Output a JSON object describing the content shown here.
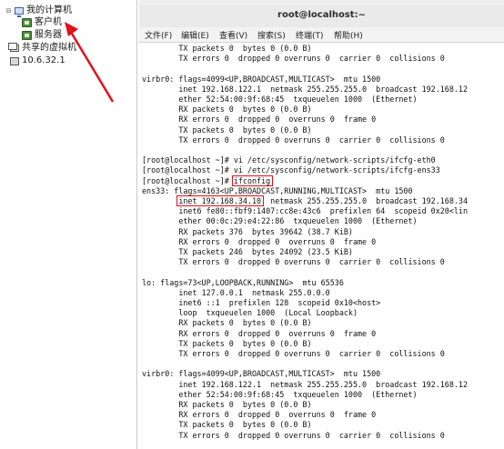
{
  "tree": {
    "items": [
      {
        "label": "我的计算机",
        "icon": "computer-icon",
        "twisty": "⊟"
      },
      {
        "label": "客户机",
        "icon": "vm-icon"
      },
      {
        "label": "服务器",
        "icon": "vm-icon"
      },
      {
        "label": "共享的虚拟机",
        "icon": "shared-vms-icon"
      },
      {
        "label": "10.6.32.1",
        "icon": "remote-host-icon"
      }
    ]
  },
  "window": {
    "title": "root@localhost:~",
    "menu": [
      "文件(F)",
      "编辑(E)",
      "查看(V)",
      "搜索(S)",
      "终端(T)",
      "帮助(H)"
    ]
  },
  "terminal": {
    "lines": [
      "        TX packets 0  bytes 0 (0.0 B)",
      "        TX errors 0  dropped 0 overruns 0  carrier 0  collisions 0",
      "",
      "virbr0: flags=4099<UP,BROADCAST,MULTICAST>  mtu 1500",
      "        inet 192.168.122.1  netmask 255.255.255.0  broadcast 192.168.12",
      "        ether 52:54:00:9f:68:45  txqueuelen 1000  (Ethernet)",
      "        RX packets 0  bytes 0 (0.0 B)",
      "        RX errors 0  dropped 0  overruns 0  frame 0",
      "        TX packets 0  bytes 0 (0.0 B)",
      "        TX errors 0  dropped 0 overruns 0  carrier 0  collisions 0",
      "",
      "[root@localhost ~]# vi /etc/sysconfig/network-scripts/ifcfg-eth0",
      "[root@localhost ~]# vi /etc/sysconfig/network-scripts/ifcfg-ens33",
      "[root@localhost ~]# ifconfig",
      "ens33: flags=4163<UP,BROADCAST,RUNNING,MULTICAST>  mtu 1500",
      "        inet 192.168.34.10  netmask 255.255.255.0  broadcast 192.168.34",
      "        inet6 fe80::fbf9:1407:cc8e:43c6  prefixlen 64  scopeid 0x20<lin",
      "        ether 00:0c:29:e4:22:86  txqueuelen 1000  (Ethernet)",
      "        RX packets 376  bytes 39642 (38.7 KiB)",
      "        RX errors 0  dropped 0  overruns 0  frame 0",
      "        TX packets 246  bytes 24092 (23.5 KiB)",
      "        TX errors 0  dropped 0 overruns 0  carrier 0  collisions 0",
      "",
      "lo: flags=73<UP,LOOPBACK,RUNNING>  mtu 65536",
      "        inet 127.0.0.1  netmask 255.0.0.0",
      "        inet6 ::1  prefixlen 128  scopeid 0x10<host>",
      "        loop  txqueuelen 1000  (Local Loopback)",
      "        RX packets 0  bytes 0 (0.0 B)",
      "        RX errors 0  dropped 0  overruns 0  frame 0",
      "        TX packets 0  bytes 0 (0.0 B)",
      "        TX errors 0  dropped 0 overruns 0  carrier 0  collisions 0",
      "",
      "virbr0: flags=4099<UP,BROADCAST,MULTICAST>  mtu 1500",
      "        inet 192.168.122.1  netmask 255.255.255.0  broadcast 192.168.12",
      "        ether 52:54:00:9f:68:45  txqueuelen 1000  (Ethernet)",
      "        RX packets 0  bytes 0 (0.0 B)",
      "        RX errors 0  dropped 0  overruns 0  frame 0",
      "        TX packets 0  bytes 0 (0.0 B)",
      "        TX errors 0  dropped 0 overruns 0  carrier 0  collisions 0"
    ]
  },
  "annotations": {
    "highlight_color": "#e0101c",
    "highlighted_command": "ifconfig",
    "highlighted_address": "inet 192.168.34.10"
  }
}
